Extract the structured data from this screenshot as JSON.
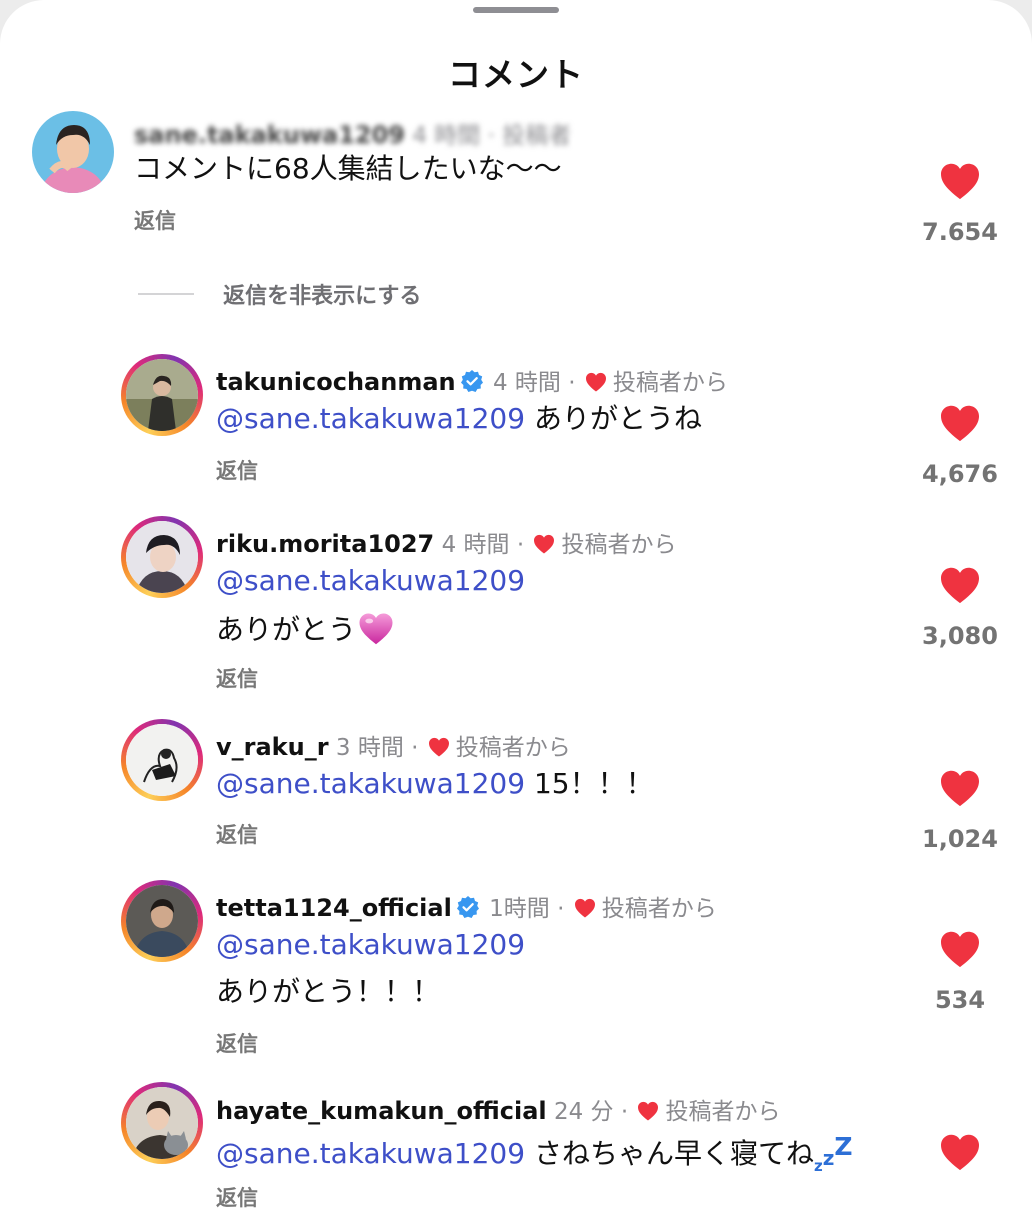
{
  "title": "コメント",
  "author_label": "投稿者",
  "from_author_label": "投稿者から",
  "reply_label": "返信",
  "hide_replies_label": "返信を非表示にする",
  "mention": "@sane.takakuwa1209",
  "colors": {
    "heart": "#ef3340",
    "mention": "#3e4fc8",
    "verified": "#3897f0"
  },
  "parent": {
    "username": "sane.takakuwa1209",
    "time": "4 時間",
    "text": "コメントに68人集結したいな〜〜",
    "likes": "7.654"
  },
  "replies": [
    {
      "username": "takunicochanman",
      "verified": true,
      "time": "4 時間",
      "lines": [
        "ありがとうね"
      ],
      "likes": "4,676"
    },
    {
      "username": "riku.morita1027",
      "verified": false,
      "time": "4 時間",
      "lines": [
        "",
        "ありがとう"
      ],
      "emoji": "pink-heart-icon",
      "likes": "3,080"
    },
    {
      "username": "v_raku_r",
      "verified": false,
      "time": "3 時間",
      "lines": [
        "15！！！"
      ],
      "likes": "1,024"
    },
    {
      "username": "tetta1124_official",
      "verified": true,
      "time": "1時間",
      "lines": [
        "",
        "ありがとう！！！"
      ],
      "likes": "534"
    },
    {
      "username": "hayate_kumakun_official",
      "verified": false,
      "time": "24 分",
      "lines": [
        "さねちゃん早く寝てね"
      ],
      "emoji": "zzz-icon",
      "likes": ""
    }
  ]
}
